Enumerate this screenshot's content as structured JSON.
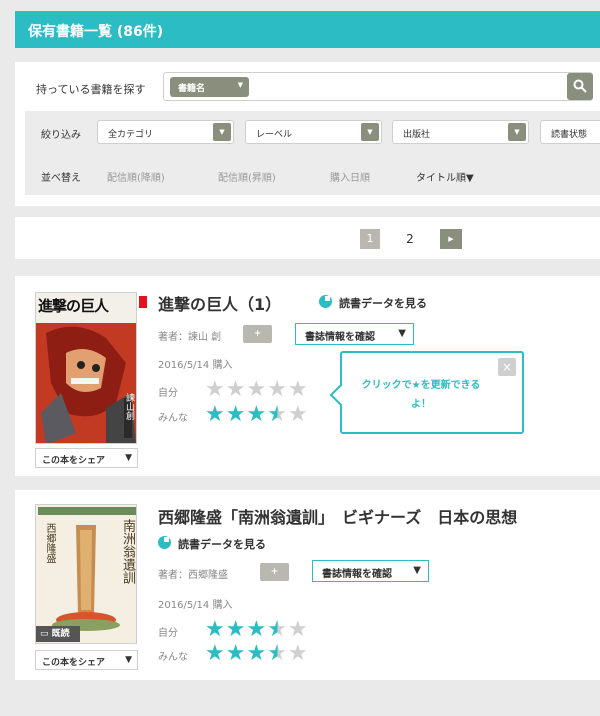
{
  "header": {
    "title": "保有書籍一覧 (86件)"
  },
  "search": {
    "label": "持っている書籍を探す",
    "category_select": "書籍名",
    "search_icon": "search-icon"
  },
  "filter": {
    "label": "絞り込み",
    "selects": [
      "全カテゴリ",
      "レーベル",
      "出版社",
      "読書状態"
    ]
  },
  "sort": {
    "label": "並べ替え",
    "options": [
      "配信順(降順)",
      "配信順(昇順)",
      "購入日順",
      "タイトル順▼"
    ],
    "active_index": 3
  },
  "pagination": {
    "pages": [
      "1",
      "2"
    ],
    "current": "1",
    "next_icon": "next-page-icon"
  },
  "books": [
    {
      "title": "進撃の巨人（1）",
      "read_link": "読書データを見る",
      "author_label": "著者：",
      "author": "諫山 創",
      "follow_label": "+",
      "info_button": "書誌情報を確認 ▼",
      "date": "2016/5/14 購入",
      "my_label": "自分",
      "everyone_label": "みんな",
      "my_rating": 0,
      "everyone_rating": 3.5,
      "share_button": "この本をシェア ▼",
      "cover_title": "進撃の巨人",
      "cover_author": "諫山創",
      "tooltip": "クリックで★を更新できるよ！",
      "tooltip_close": "×"
    },
    {
      "title": "西郷隆盛「南洲翁遺訓」　ビギナーズ　日本の思想",
      "read_link": "読書データを見る",
      "author_label": "著者：",
      "author": "西郷隆盛",
      "follow_label": "+",
      "info_button": "書誌情報を確認 ▼",
      "date": "2016/5/14 購入",
      "my_label": "自分",
      "everyone_label": "みんな",
      "my_rating": 3.5,
      "everyone_rating": 3.5,
      "share_button": "この本をシェア ▼",
      "read_badge": "既読",
      "cover_title": "南洲翁遺訓",
      "cover_author": "西郷隆盛"
    }
  ],
  "colors": {
    "accent": "#2bbcc4",
    "button_gray": "#8a8e7d",
    "red_mark": "#e8101f"
  }
}
